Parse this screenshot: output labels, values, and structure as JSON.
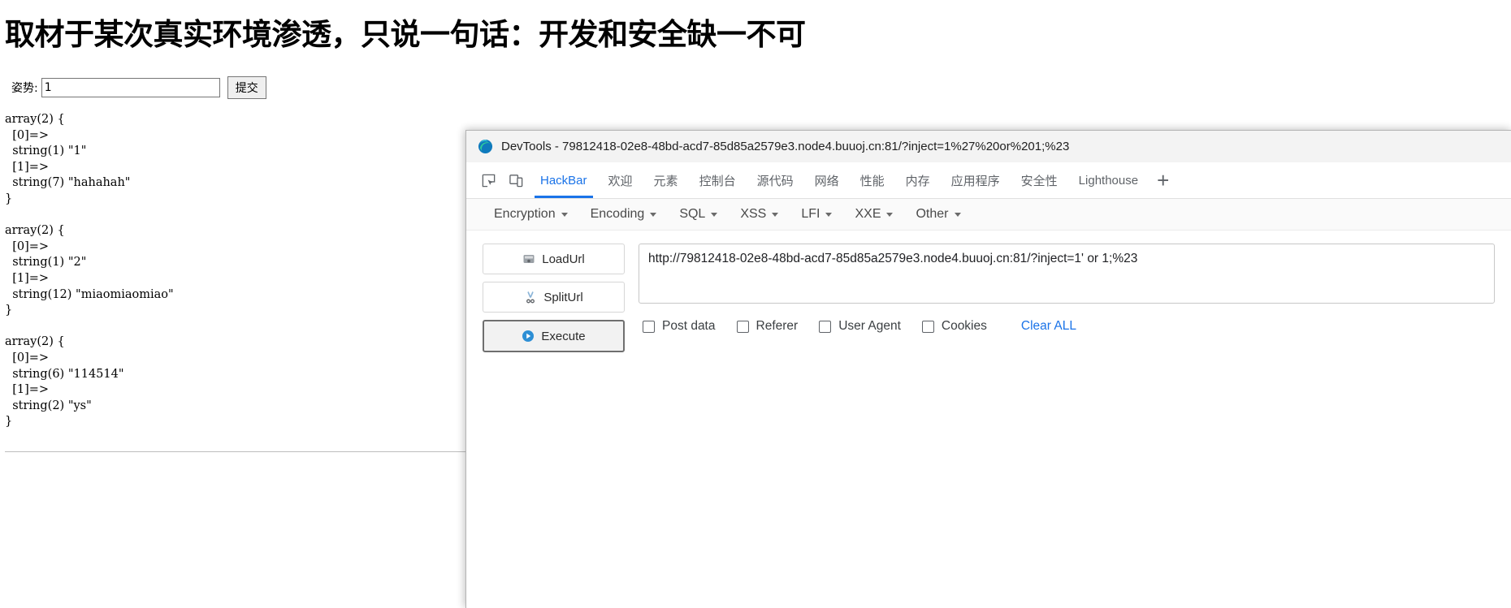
{
  "page": {
    "heading": "取材于某次真实环境渗透，只说一句话：开发和安全缺一不可",
    "form": {
      "label": "姿势:",
      "input_value": "1",
      "input_placeholder": "",
      "submit_label": "提交"
    },
    "dump_output": "array(2) {\n  [0]=>\n  string(1) \"1\"\n  [1]=>\n  string(7) \"hahahah\"\n}\n\narray(2) {\n  [0]=>\n  string(1) \"2\"\n  [1]=>\n  string(12) \"miaomiaomiao\"\n}\n\narray(2) {\n  [0]=>\n  string(6) \"114514\"\n  [1]=>\n  string(2) \"ys\"\n}"
  },
  "devtools": {
    "title": "DevTools - 79812418-02e8-48bd-acd7-85d85a2579e3.node4.buuoj.cn:81/?inject=1%27%20or%201;%23",
    "logo_icon": "edge-logo-icon",
    "tool_icons": [
      {
        "name": "inspect-element-icon"
      },
      {
        "name": "device-toolbar-icon"
      }
    ],
    "tabs": [
      {
        "label": "HackBar",
        "active": true
      },
      {
        "label": "欢迎",
        "active": false
      },
      {
        "label": "元素",
        "active": false
      },
      {
        "label": "控制台",
        "active": false
      },
      {
        "label": "源代码",
        "active": false
      },
      {
        "label": "网络",
        "active": false
      },
      {
        "label": "性能",
        "active": false
      },
      {
        "label": "内存",
        "active": false
      },
      {
        "label": "应用程序",
        "active": false
      },
      {
        "label": "安全性",
        "active": false
      },
      {
        "label": "Lighthouse",
        "active": false
      }
    ],
    "add_tab_label": "+",
    "accent_color": "#1a73e8"
  },
  "hackbar": {
    "menus": [
      {
        "label": "Encryption"
      },
      {
        "label": "Encoding"
      },
      {
        "label": "SQL"
      },
      {
        "label": "XSS"
      },
      {
        "label": "LFI"
      },
      {
        "label": "XXE"
      },
      {
        "label": "Other"
      }
    ],
    "actions": [
      {
        "label": "LoadUrl",
        "icon": "load-url-icon",
        "focused": false
      },
      {
        "label": "SplitUrl",
        "icon": "split-url-icon",
        "focused": false
      },
      {
        "label": "Execute",
        "icon": "execute-icon",
        "focused": true
      }
    ],
    "url_value": "http://79812418-02e8-48bd-acd7-85d85a2579e3.node4.buuoj.cn:81/?inject=1' or 1;%23",
    "options": [
      {
        "label": "Post data",
        "checked": false
      },
      {
        "label": "Referer",
        "checked": false
      },
      {
        "label": "User Agent",
        "checked": false
      },
      {
        "label": "Cookies",
        "checked": false
      }
    ],
    "clear_all_label": "Clear ALL",
    "link_color": "#1a73e8"
  }
}
